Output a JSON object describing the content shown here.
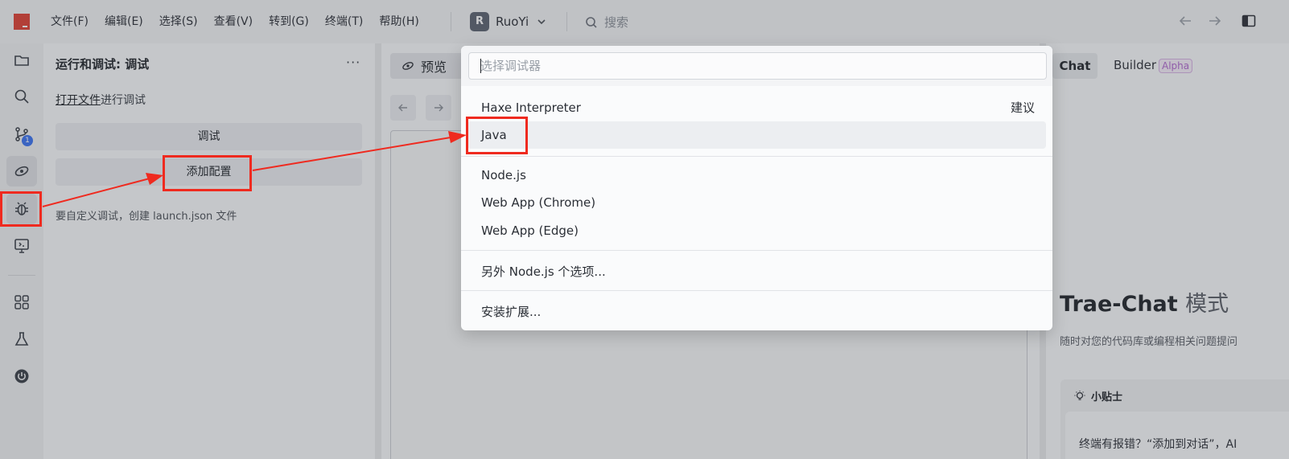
{
  "menu": [
    "文件(F)",
    "编辑(E)",
    "选择(S)",
    "查看(V)",
    "转到(G)",
    "终端(T)",
    "帮助(H)"
  ],
  "project": {
    "initial": "R",
    "name": "RuoYi"
  },
  "search": {
    "label": "搜索"
  },
  "activity": {
    "scm_badge": "1"
  },
  "sidebar": {
    "title": "运行和调试: 调试",
    "more": "···",
    "open_file_link": "打开文件",
    "open_file_suffix": "进行调试",
    "debug_button": "调试",
    "add_config_button": "添加配置",
    "hint": "要自定义调试，创建 launch.json 文件"
  },
  "editor": {
    "tab_label": "预览"
  },
  "chat": {
    "tab_chat": "Chat",
    "tab_builder": "Builder",
    "alpha": "Alpha",
    "title_main": "Trae-Chat",
    "title_light": "模式",
    "subtitle": "随时对您的代码库或编程相关问题提问",
    "tip_title": "小贴士",
    "tip_text": "终端有报错？“添加到对话”，AI"
  },
  "quickpick": {
    "placeholder": "选择调试器",
    "items": [
      {
        "label": "Haxe Interpreter",
        "hint": "建议"
      },
      {
        "label": "Java"
      },
      {
        "label": "Node.js"
      },
      {
        "label": "Web App (Chrome)"
      },
      {
        "label": "Web App (Edge)"
      },
      {
        "label": "另外 Node.js 个选项..."
      },
      {
        "label": "安装扩展..."
      }
    ]
  },
  "colors": {
    "annotation": "#ef2a1f",
    "accent": "#3a72f2",
    "brand": "#e03f33"
  }
}
